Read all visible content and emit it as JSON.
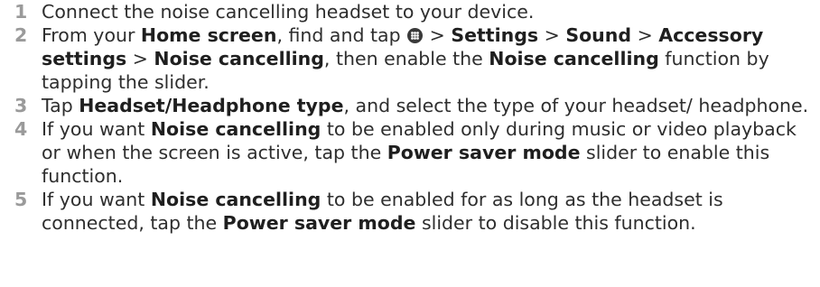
{
  "steps": [
    {
      "num": "1",
      "text": {
        "t1": "Connect the noise cancelling headset to your device."
      }
    },
    {
      "num": "2",
      "text": {
        "t1": "From your ",
        "b1": "Home screen",
        "t2": ", find and tap ",
        "icon": "apps-icon",
        "t3": " > ",
        "b2": "Settings",
        "t4": " > ",
        "b3": "Sound",
        "t5": " > ",
        "b4": "Accessory settings",
        "t6": " > ",
        "b5": "Noise cancelling",
        "t7": ", then enable the ",
        "b6": "Noise cancelling",
        "t8": " function by tapping the slider."
      }
    },
    {
      "num": "3",
      "text": {
        "t1": "Tap ",
        "b1": "Headset/Headphone type",
        "t2": ", and select the type of your headset/ headphone."
      }
    },
    {
      "num": "4",
      "text": {
        "t1": "If you want ",
        "b1": "Noise cancelling",
        "t2": " to be enabled only during music or video playback or when the screen is active, tap the ",
        "b2": "Power saver mode",
        "t3": " slider to enable this function."
      }
    },
    {
      "num": "5",
      "text": {
        "t1": "If you want ",
        "b1": "Noise cancelling",
        "t2": " to be enabled for as long as the headset is connected, tap the ",
        "b2": "Power saver mode",
        "t3": " slider to disable this function."
      }
    }
  ],
  "colors": {
    "text": "#2e2e2e",
    "step_number": "#9a9a9a",
    "bold_text": "#1f1f1f",
    "icon_fill": "#3a3a3a"
  }
}
